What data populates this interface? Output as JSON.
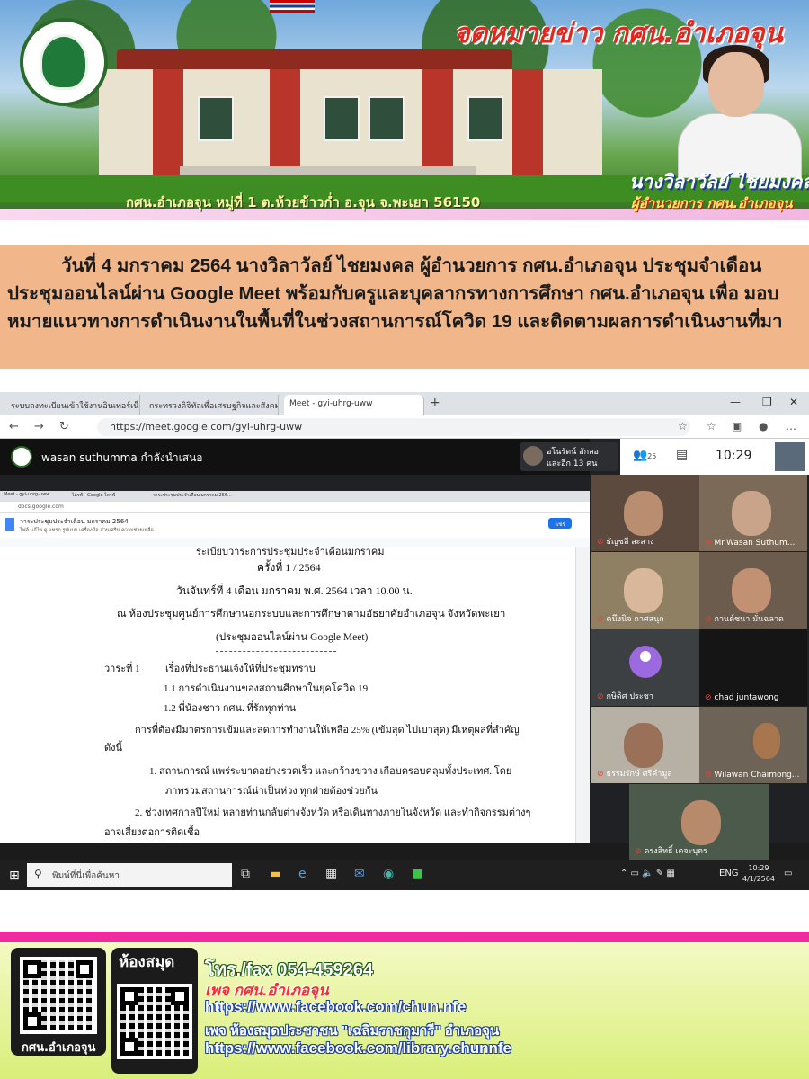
{
  "banner": {
    "title": "จดหมายข่าว กศน.อำเภอจุน",
    "address": "กศน.อำเภอจุน หมู่ที่ 1 ต.ห้วยข้าวก่ำ อ.จุน จ.พะเยา 56150",
    "director_name": "นางวิลาวัลย์ ไชยมงคล",
    "director_role": "ผู้อำนวยการ กศน.อำเภอจุน"
  },
  "headline": "วันที่ 4 มกราคม 2564 นางวิลาวัลย์ ไชยมงคล ผู้อำนวยการ กศน.อำเภอจุน ประชุมจำเดือน ประชุมออนไลน์ผ่าน Google Meet พร้อมกับครูและบุคลากรทางการศึกษา กศน.อำเภอจุน เพื่อ มอบหมายแนวทางการดำเนินงานในพื้นที่ในช่วงสถานการณ์โควิด 19 และติดตามผลการดำเนินงานที่มา",
  "browser": {
    "tabs": [
      "ระบบลงทะเบียนเข้าใช้งานอินเทอร์เน็ต",
      "กระทรวงดิจิทัลเพื่อเศรษฐกิจและสังคม",
      "Meet - gyi-uhrg-uww"
    ],
    "url": "https://meet.google.com/gyi-uhrg-uww"
  },
  "meet": {
    "presenter": "wasan suthumma กำลังนำเสนอ",
    "joiner_name": "อโนรัตน์ สักลอ",
    "joiner_more": "และอีก 13 คน",
    "people_count": "25",
    "time": "10:29",
    "participants": [
      "ธัญชลี สะสาง",
      "Mr.Wasan Suthum...",
      "คนึงนิจ กาศสนุก",
      "กานต์ชนา มั่นฉลาด",
      "กษิดิศ ประชา",
      "chad juntawong",
      "ธรรมรักษ์ ศรีคำมูล",
      "Wilawan Chaimong...",
      "ดรงสิทธิ์ เดจะบุตร"
    ]
  },
  "doc": {
    "title": "วาระประชุมประจำเดือน มกราคม 2564",
    "share": "แชร์",
    "lines": {
      "cut_heading": "ระเบียบวาระการประชุมประจำเดือนมกราคม",
      "time_no": "ครั้งที่  1 / 2564",
      "date": "วันจันทร์ที่ 4 เดือน มกราคม พ.ศ.  2564  เวลา  10.00 น.",
      "place": "ณ ห้องประชุมศูนย์การศึกษานอกระบบและการศึกษาตามอัธยาศัยอำเภอจุน  จังหวัดพะเยา",
      "online": "(ประชุมออนไลน์ผ่าน Google Meet)",
      "agenda_no": "วาระที่ 1",
      "agenda_title": "เรื่องที่ประธานแจ้งให้ที่ประชุมทราบ",
      "item_1_1": "1.1 การดำเนินงานของสถานศึกษาในยุคโควิด 19",
      "item_1_2": "1.2 พี่น้องชาว กศน. ที่รักทุกท่าน",
      "para_1": "การที่ต้องมีมาตรการเข้มและลดการทำงานให้เหลือ 25% (เข้มสุด ไปเบาสุด) มีเหตุผลที่สำคัญ",
      "para_1b": "ดังนี้",
      "bullet_1": "1.   สถานการณ์ แพร่ระบาดอย่างรวดเร็ว และกว้างขวาง เกือบครอบคลุมทั้งประเทศ. โดย",
      "bullet_1b": "ภาพรวมสถานการณ์น่าเป็นห่วง ทุกฝ่ายต้องช่วยกัน",
      "bullet_2": "2. ช่วงเทศกาลปีใหม่ หลายท่านกลับต่างจังหวัด หรือเดินทางภายในจังหวัด และทำกิจกรรมต่างๆ",
      "bullet_2b": "อาจเสี่ยงต่อการติดเชื้อ"
    }
  },
  "taskbar": {
    "search_placeholder": "พิมพ์ที่นี่เพื่อค้นหา",
    "lang": "ENG",
    "clock_time": "10:29",
    "clock_date": "4/1/2564"
  },
  "footer": {
    "qr_label": "กศน.อำเภอจุน",
    "library_label": "ห้องสมุด",
    "tel": "โทร./fax  054-459264",
    "page_label": "เพจ กศน.อำเภอจุน",
    "url_main": "https://www.facebook.com/chun.nfe",
    "library_page": "เพจ ห้องสมุดประชาชน \"เฉลิมราชกุมารี\" อำเภอจุน",
    "url_library": "https://www.facebook.com/library.chunnfe"
  }
}
